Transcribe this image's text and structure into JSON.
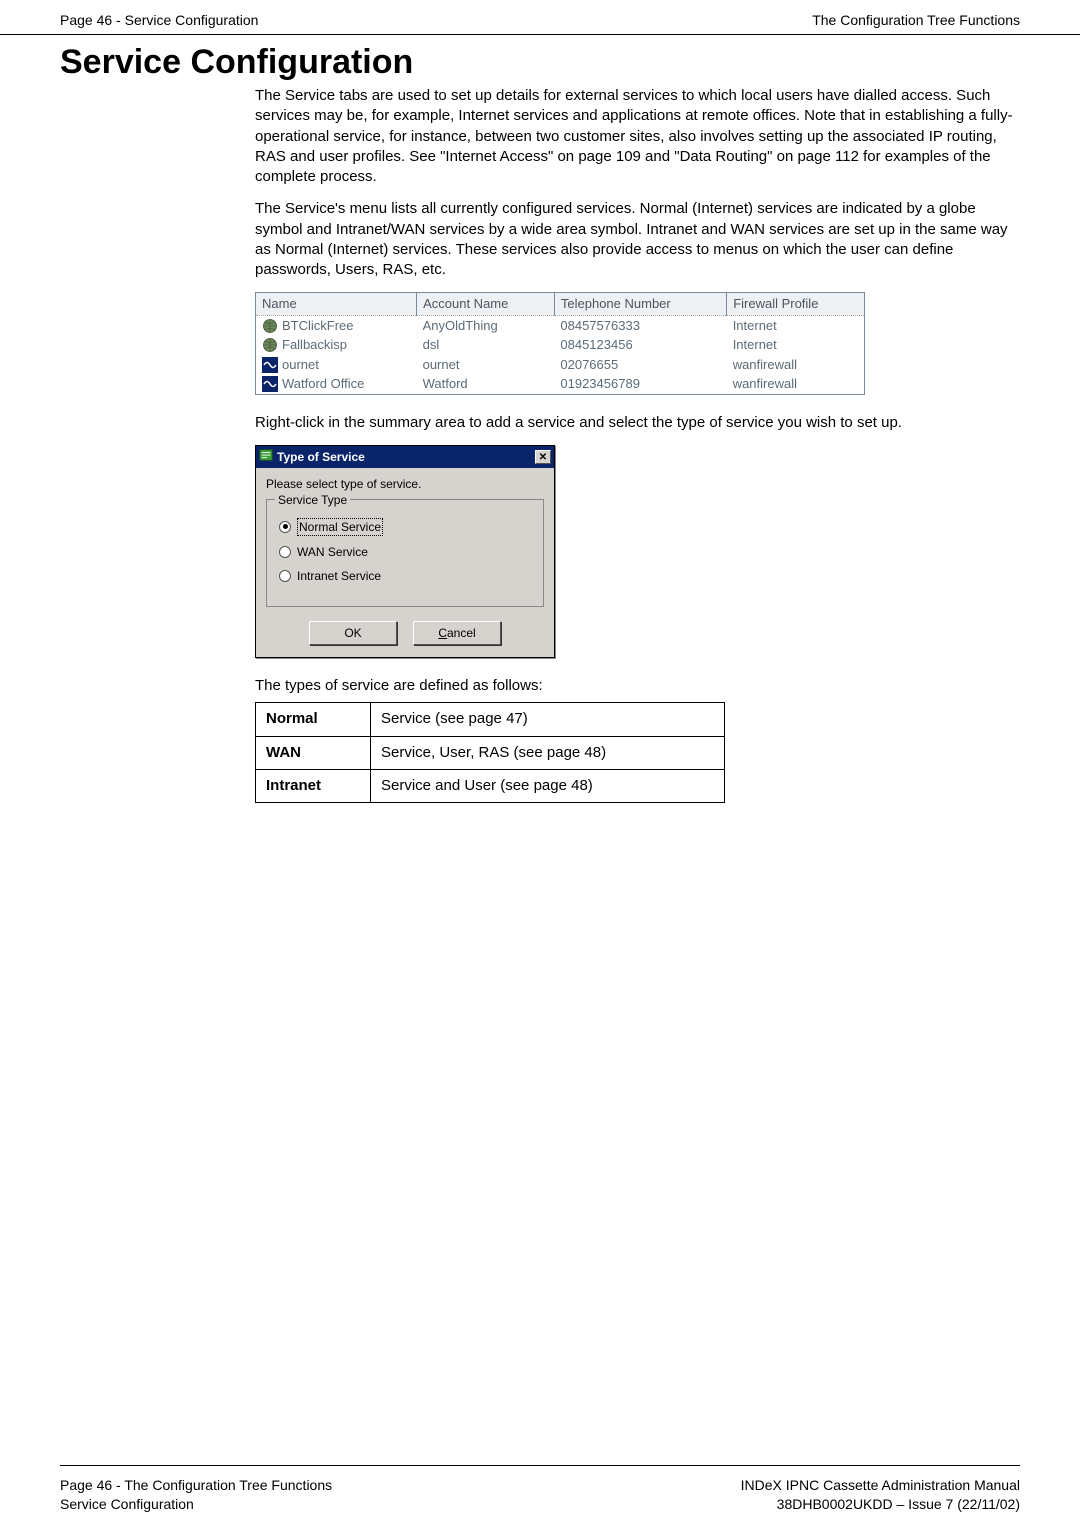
{
  "header": {
    "left": "Page 46 - Service Configuration",
    "right": "The Configuration Tree Functions"
  },
  "title": "Service Configuration",
  "para1": "The Service tabs are used to set up details for external services to which local users have dialled access. Such services may be, for example, Internet services and applications at remote offices. Note that in establishing a fully-operational service, for instance, between two customer sites, also involves setting up the associated IP routing, RAS and user profiles. See \"Internet Access\" on page 109 and \"Data Routing\" on page 112 for examples of the complete process.",
  "para2": "The Service's menu lists all currently configured services. Normal (Internet) services are indicated by a globe symbol and Intranet/WAN services by a wide area symbol. Intranet and WAN services are set up in the same way as Normal (Internet) services. These services also provide access to menus on which the user can define passwords, Users, RAS, etc.",
  "services_table": {
    "columns": [
      "Name",
      "Account Name",
      "Telephone Number",
      "Firewall Profile"
    ],
    "rows": [
      {
        "icon": "globe",
        "name": "BTClickFree",
        "account": "AnyOldThing",
        "tel": "08457576333",
        "fw": "Internet"
      },
      {
        "icon": "globe",
        "name": "Fallbackisp",
        "account": "dsl",
        "tel": "0845123456",
        "fw": "Internet"
      },
      {
        "icon": "wan",
        "name": "ournet",
        "account": "ournet",
        "tel": "02076655",
        "fw": "wanfirewall"
      },
      {
        "icon": "wan",
        "name": "Watford Office",
        "account": "Watford",
        "tel": "01923456789",
        "fw": "wanfirewall"
      }
    ]
  },
  "para3": "Right-click in the summary area to add a service and select the type of service you wish to set up.",
  "dialog": {
    "title": "Type of Service",
    "instruction": "Please select type of service.",
    "group_label": "Service Type",
    "options": {
      "normal": "Normal Service",
      "wan": "WAN Service",
      "intranet": "Intranet Service"
    },
    "ok": "OK",
    "cancel": "Cancel"
  },
  "para4": "The types of service are defined as follows:",
  "types_table": {
    "rows": [
      {
        "label": "Normal",
        "desc": "Service (see page 47)"
      },
      {
        "label": "WAN",
        "desc": "Service, User, RAS (see page 48)"
      },
      {
        "label": "Intranet",
        "desc": "Service and User (see page 48)"
      }
    ]
  },
  "footer": {
    "left1": "Page 46 - The Configuration Tree Functions",
    "left2": "Service Configuration",
    "right1": "INDeX IPNC Cassette Administration Manual",
    "right2": "38DHB0002UKDD – Issue 7 (22/11/02)"
  }
}
